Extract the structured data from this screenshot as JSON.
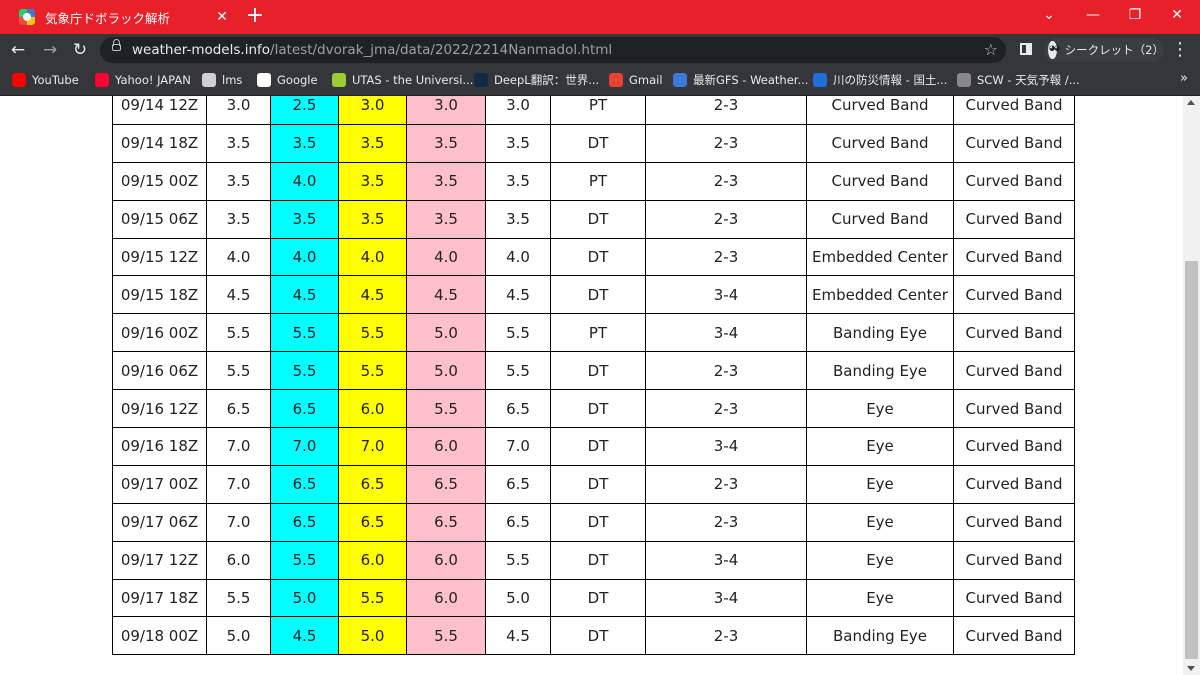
{
  "tab": {
    "title": "気象庁ドボラック解析",
    "close_glyph": "✕"
  },
  "new_tab_glyph": "+",
  "window_controls": {
    "dropdown": "⌄",
    "minimize": "—",
    "restore": "❐",
    "close": "✕"
  },
  "toolbar": {
    "back": "←",
    "forward": "→",
    "reload": "↻",
    "url_host": "weather-models.info",
    "url_path": "/latest/dvorak_jma/data/2022/2214Nanmadol.html",
    "star": "☆",
    "incognito_label": "シークレット（2）",
    "menu": "⋮"
  },
  "bookmarks": [
    {
      "label": "YouTube",
      "icon": "youtube-icon",
      "color": "#ff0000"
    },
    {
      "label": "Yahoo! JAPAN",
      "icon": "yahoo-icon",
      "color": "#ff0033"
    },
    {
      "label": "lms",
      "icon": "lms-icon",
      "color": "#d0d0d0"
    },
    {
      "label": "Google",
      "icon": "google-icon",
      "color": "#ffffff"
    },
    {
      "label": "UTAS - the Universi...",
      "icon": "utas-icon",
      "color": "#9acd32"
    },
    {
      "label": "DeepL翻訳：世界...",
      "icon": "deepl-icon",
      "color": "#0f2b46"
    },
    {
      "label": "Gmail",
      "icon": "gmail-icon",
      "color": "#ea4335"
    },
    {
      "label": "最新GFS - Weather...",
      "icon": "weather-models-icon",
      "color": "#3a7bd5"
    },
    {
      "label": "川の防災情報 - 国土...",
      "icon": "river-icon",
      "color": "#1e6fd9"
    },
    {
      "label": "SCW - 天気予報 /...",
      "icon": "scw-icon",
      "color": "#888888"
    }
  ],
  "bookmarks_overflow": "»",
  "table": {
    "rows": [
      [
        "09/14 12Z",
        "3.0",
        "2.5",
        "3.0",
        "3.0",
        "3.0",
        "PT",
        "2-3",
        "Curved Band",
        "Curved Band"
      ],
      [
        "09/14 18Z",
        "3.5",
        "3.5",
        "3.5",
        "3.5",
        "3.5",
        "DT",
        "2-3",
        "Curved Band",
        "Curved Band"
      ],
      [
        "09/15 00Z",
        "3.5",
        "4.0",
        "3.5",
        "3.5",
        "3.5",
        "PT",
        "2-3",
        "Curved Band",
        "Curved Band"
      ],
      [
        "09/15 06Z",
        "3.5",
        "3.5",
        "3.5",
        "3.5",
        "3.5",
        "DT",
        "2-3",
        "Curved Band",
        "Curved Band"
      ],
      [
        "09/15 12Z",
        "4.0",
        "4.0",
        "4.0",
        "4.0",
        "4.0",
        "DT",
        "2-3",
        "Embedded Center",
        "Curved Band"
      ],
      [
        "09/15 18Z",
        "4.5",
        "4.5",
        "4.5",
        "4.5",
        "4.5",
        "DT",
        "3-4",
        "Embedded Center",
        "Curved Band"
      ],
      [
        "09/16 00Z",
        "5.5",
        "5.5",
        "5.5",
        "5.0",
        "5.5",
        "PT",
        "3-4",
        "Banding Eye",
        "Curved Band"
      ],
      [
        "09/16 06Z",
        "5.5",
        "5.5",
        "5.5",
        "5.0",
        "5.5",
        "DT",
        "2-3",
        "Banding Eye",
        "Curved Band"
      ],
      [
        "09/16 12Z",
        "6.5",
        "6.5",
        "6.0",
        "5.5",
        "6.5",
        "DT",
        "2-3",
        "Eye",
        "Curved Band"
      ],
      [
        "09/16 18Z",
        "7.0",
        "7.0",
        "7.0",
        "6.0",
        "7.0",
        "DT",
        "3-4",
        "Eye",
        "Curved Band"
      ],
      [
        "09/17 00Z",
        "7.0",
        "6.5",
        "6.5",
        "6.5",
        "6.5",
        "DT",
        "2-3",
        "Eye",
        "Curved Band"
      ],
      [
        "09/17 06Z",
        "7.0",
        "6.5",
        "6.5",
        "6.5",
        "6.5",
        "DT",
        "2-3",
        "Eye",
        "Curved Band"
      ],
      [
        "09/17 12Z",
        "6.0",
        "5.5",
        "6.0",
        "6.0",
        "5.5",
        "DT",
        "3-4",
        "Eye",
        "Curved Band"
      ],
      [
        "09/17 18Z",
        "5.5",
        "5.0",
        "5.5",
        "6.0",
        "5.0",
        "DT",
        "3-4",
        "Eye",
        "Curved Band"
      ],
      [
        "09/18 00Z",
        "5.0",
        "4.5",
        "5.0",
        "5.5",
        "4.5",
        "DT",
        "2-3",
        "Banding Eye",
        "Curved Band"
      ]
    ],
    "column_colors": [
      "",
      "",
      "#00ffff",
      "#ffff00",
      "#ffc0cb",
      "",
      "",
      "",
      "",
      ""
    ]
  }
}
